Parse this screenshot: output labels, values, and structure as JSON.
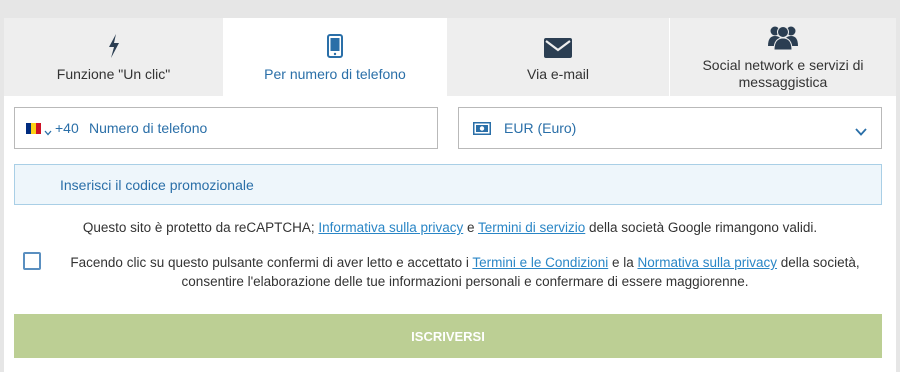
{
  "tabs": [
    {
      "label": "Funzione \"Un clic\"",
      "icon": "lightning-icon"
    },
    {
      "label": "Per numero di telefono",
      "icon": "smartphone-icon"
    },
    {
      "label": "Via e-mail",
      "icon": "envelope-icon"
    },
    {
      "label": "Social network e servizi di messaggistica",
      "icon": "users-group-icon"
    }
  ],
  "active_tab": 1,
  "phone": {
    "country_flag": "romania-flag",
    "prefix": "+40",
    "placeholder": "Numero di telefono",
    "value": ""
  },
  "currency": {
    "selected": "EUR (Euro)",
    "icon": "banknote-icon"
  },
  "promo": {
    "placeholder": "Inserisci il codice promozionale",
    "value": ""
  },
  "captcha": {
    "text_before": "Questo sito è protetto da reCAPTCHA; ",
    "privacy_link": "Informativa sulla privacy",
    "and": " e ",
    "terms_link": "Termini di servizio",
    "text_after": " della società Google rimangono validi."
  },
  "consent": {
    "checked": false,
    "text_before": "Facendo clic su questo pulsante confermi di aver letto e accettato i ",
    "terms_link": "Termini e le Condizioni",
    "and": " e la ",
    "privacy_link": "Normativa sulla privacy",
    "text_after": " della società, consentire l'elaborazione delle tue informazioni personali e confermare di essere maggiorenne."
  },
  "submit_label": "ISCRIVERSI",
  "colors": {
    "accent": "#2a6fa8",
    "link": "#2a86c6",
    "submit_bg": "#bccf94",
    "tab_bg": "#eeeeee",
    "promo_bg": "#eef6fb",
    "flag_blue": "#002b7f",
    "flag_yellow": "#fcd116",
    "flag_red": "#ce1126"
  }
}
